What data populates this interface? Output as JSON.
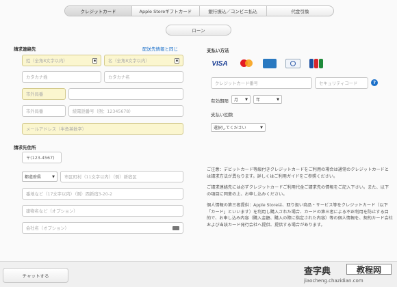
{
  "tabs": [
    "クレジットカード",
    "Apple Storeギフトカード",
    "銀行振込／コンビニ払込",
    "代金引換"
  ],
  "loan_label": "ローン",
  "billing": {
    "title": "請求連絡先",
    "copy_link": "配送先情報と同じ",
    "last_name": "姓（全角8文字以内）",
    "first_name": "名（全角8文字以内）",
    "kana_last": "カタカナ姓",
    "kana_first": "カタカナ名",
    "area_code": "市外局番",
    "area_code2": "市外局番",
    "phone": "続電話番号（例：12345678）",
    "email": "メールアドレス（半角英数字）"
  },
  "address": {
    "title": "請求先住所",
    "postal": "〒(123-4567)",
    "prefecture": "都道府県",
    "city": "市区町村（11文字以内）（例）新宿区",
    "street": "番地など（17文字以内）（例）西新宿3-20-2",
    "building": "建物名など（オプション）",
    "company": "会社名（オプション）"
  },
  "payment": {
    "title": "支払い方法",
    "visa": "VISA",
    "card_number": "クレジットカード番号",
    "security_code": "セキュリティコード",
    "help": "?",
    "expiry_label": "有効期限",
    "month": "月",
    "year": "年",
    "installments_label": "支払い回数",
    "installments_placeholder": "選択してください"
  },
  "notes": [
    "ご注意：デビットカード等級付きクレジットカードをご利用の場合は通常のクレジットカードとは請求方法が異なります。詳しくはご利用ガイドをご参照ください。",
    "ご請求連絡先には必ずクレジットカードご利用代金ご請求先の情報をご記入下さい。また、以下の項目に同意の上、お申し込みください。",
    "個人情報の第三者提供：Apple Storeは、取り扱い商品・サービス等をクレジットカード（以下「カード」といいます）を利用し購入された場合、カードの第三者による不正利用を防止する目的で、お申し込み内容（購入金額、購入の際に指定された内容）等の個人情報を、契約カード会社および当該カード発行会社へ提供、提供する場合があります。"
  ],
  "chat_label": "チャットする",
  "watermark": {
    "logo": "查字典",
    "box": "教程网",
    "url": "jiaocheng.chazidian.com"
  }
}
